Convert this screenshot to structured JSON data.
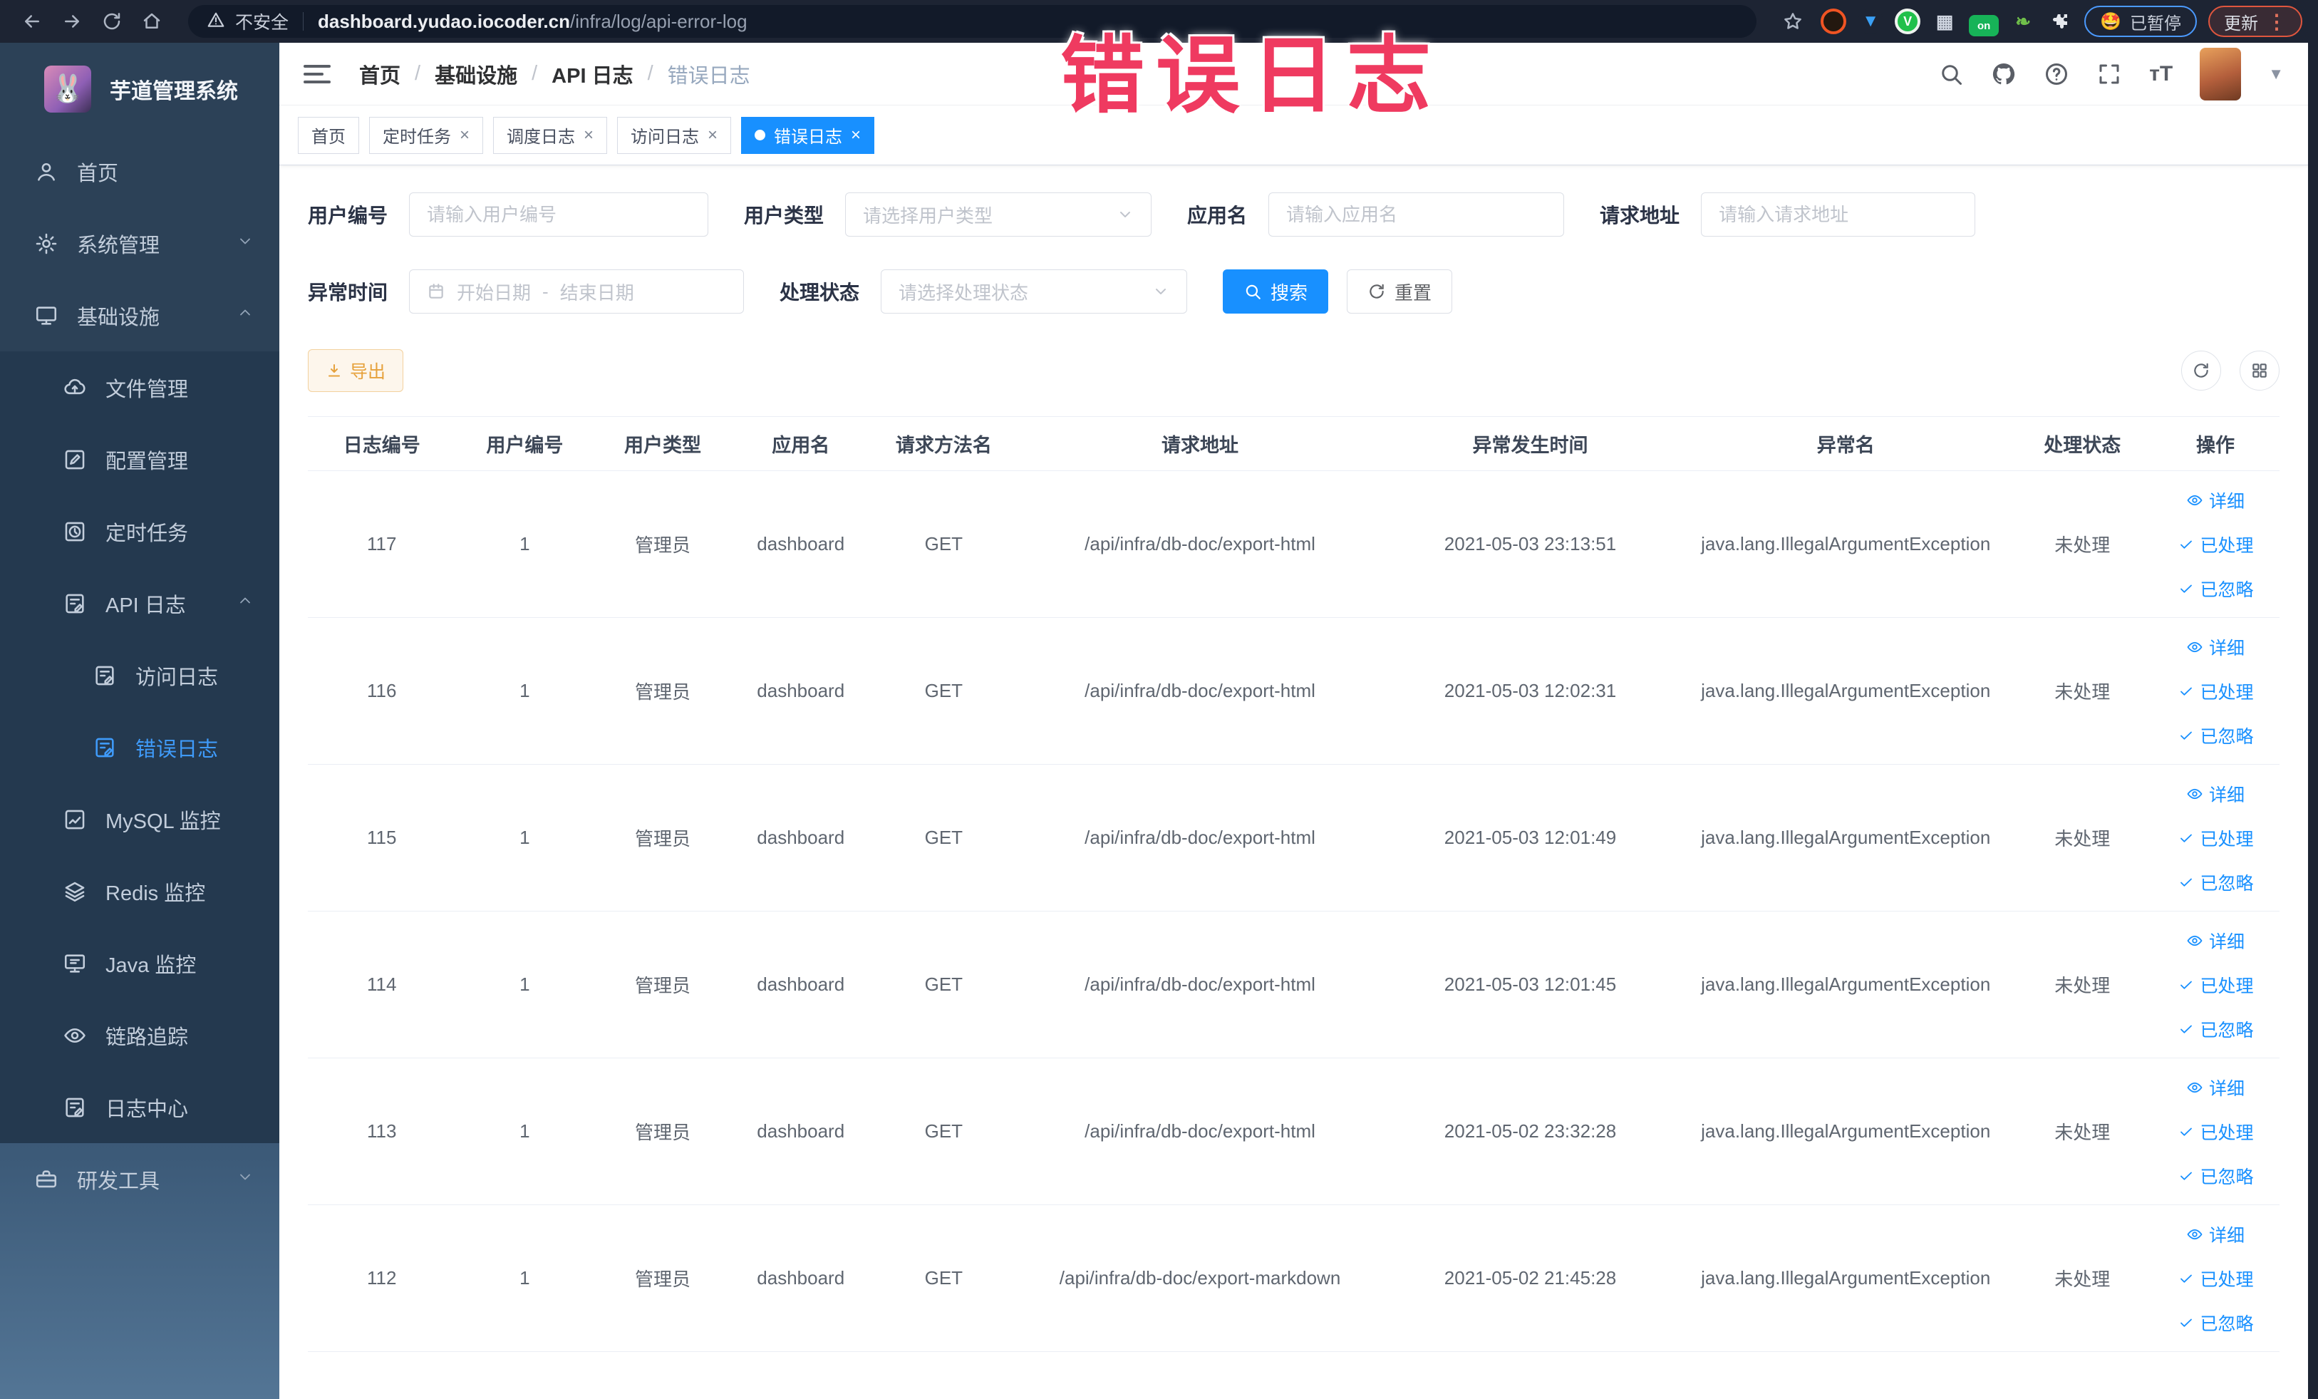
{
  "browser": {
    "security_label": "不安全",
    "url_domain": "dashboard.yudao.iocoder.cn",
    "url_path": "/infra/log/api-error-log",
    "paused_label": "已暂停",
    "paused_emoji": "🤩",
    "update_label": "更新"
  },
  "annotation": {
    "text": "错误日志",
    "color": "#ef3a60"
  },
  "app": {
    "title": "芋道管理系统",
    "breadcrumb": [
      "首页",
      "基础设施",
      "API 日志",
      "错误日志"
    ]
  },
  "sidebar": {
    "items": [
      {
        "label": "首页",
        "icon": "user",
        "level": 1,
        "group": "top"
      },
      {
        "label": "系统管理",
        "icon": "gear",
        "level": 1,
        "group": "top",
        "chevron": "down"
      },
      {
        "label": "基础设施",
        "icon": "monitor",
        "level": 1,
        "group": "top",
        "chevron": "up"
      },
      {
        "label": "文件管理",
        "icon": "cloud",
        "level": 2,
        "group": "sub"
      },
      {
        "label": "配置管理",
        "icon": "editsq",
        "level": 2,
        "group": "sub"
      },
      {
        "label": "定时任务",
        "icon": "clock",
        "level": 2,
        "group": "sub"
      },
      {
        "label": "API 日志",
        "icon": "docpen",
        "level": 2,
        "group": "sub",
        "chevron": "up"
      },
      {
        "label": "访问日志",
        "icon": "docpen",
        "level": 3,
        "group": "sub"
      },
      {
        "label": "错误日志",
        "icon": "docpen",
        "level": 3,
        "group": "sub",
        "active": true
      },
      {
        "label": "MySQL 监控",
        "icon": "chart",
        "level": 2,
        "group": "sub"
      },
      {
        "label": "Redis 监控",
        "icon": "layers",
        "level": 2,
        "group": "sub"
      },
      {
        "label": "Java 监控",
        "icon": "javamon",
        "level": 2,
        "group": "sub"
      },
      {
        "label": "链路追踪",
        "icon": "eye",
        "level": 2,
        "group": "sub"
      },
      {
        "label": "日志中心",
        "icon": "docpen",
        "level": 2,
        "group": "sub"
      },
      {
        "label": "研发工具",
        "icon": "toolbox",
        "level": 1,
        "group": "bottom",
        "chevron": "down"
      }
    ]
  },
  "tabs": [
    {
      "label": "首页",
      "closable": false,
      "active": false
    },
    {
      "label": "定时任务",
      "closable": true,
      "active": false
    },
    {
      "label": "调度日志",
      "closable": true,
      "active": false
    },
    {
      "label": "访问日志",
      "closable": true,
      "active": false
    },
    {
      "label": "错误日志",
      "closable": true,
      "active": true
    }
  ],
  "filters": {
    "user_id": {
      "label": "用户编号",
      "placeholder": "请输入用户编号"
    },
    "user_type": {
      "label": "用户类型",
      "placeholder": "请选择用户类型"
    },
    "app_name": {
      "label": "应用名",
      "placeholder": "请输入应用名"
    },
    "request_url": {
      "label": "请求地址",
      "placeholder": "请输入请求地址"
    },
    "exception_time": {
      "label": "异常时间",
      "start_placeholder": "开始日期",
      "separator": "-",
      "end_placeholder": "结束日期"
    },
    "process_status": {
      "label": "处理状态",
      "placeholder": "请选择处理状态"
    },
    "search_label": "搜索",
    "reset_label": "重置"
  },
  "toolbar": {
    "export_label": "导出"
  },
  "table": {
    "columns": [
      "日志编号",
      "用户编号",
      "用户类型",
      "应用名",
      "请求方法名",
      "请求地址",
      "异常发生时间",
      "异常名",
      "处理状态",
      "操作"
    ],
    "actions": [
      "详细",
      "已处理",
      "已忽略"
    ],
    "rows": [
      {
        "id": "117",
        "user_id": "1",
        "user_type": "管理员",
        "app": "dashboard",
        "method": "GET",
        "url": "/api/infra/db-doc/export-html",
        "time": "2021-05-03 23:13:51",
        "exception": "java.lang.IllegalArgumentException",
        "status": "未处理"
      },
      {
        "id": "116",
        "user_id": "1",
        "user_type": "管理员",
        "app": "dashboard",
        "method": "GET",
        "url": "/api/infra/db-doc/export-html",
        "time": "2021-05-03 12:02:31",
        "exception": "java.lang.IllegalArgumentException",
        "status": "未处理"
      },
      {
        "id": "115",
        "user_id": "1",
        "user_type": "管理员",
        "app": "dashboard",
        "method": "GET",
        "url": "/api/infra/db-doc/export-html",
        "time": "2021-05-03 12:01:49",
        "exception": "java.lang.IllegalArgumentException",
        "status": "未处理"
      },
      {
        "id": "114",
        "user_id": "1",
        "user_type": "管理员",
        "app": "dashboard",
        "method": "GET",
        "url": "/api/infra/db-doc/export-html",
        "time": "2021-05-03 12:01:45",
        "exception": "java.lang.IllegalArgumentException",
        "status": "未处理"
      },
      {
        "id": "113",
        "user_id": "1",
        "user_type": "管理员",
        "app": "dashboard",
        "method": "GET",
        "url": "/api/infra/db-doc/export-html",
        "time": "2021-05-02 23:32:28",
        "exception": "java.lang.IllegalArgumentException",
        "status": "未处理"
      },
      {
        "id": "112",
        "user_id": "1",
        "user_type": "管理员",
        "app": "dashboard",
        "method": "GET",
        "url": "/api/infra/db-doc/export-markdown",
        "time": "2021-05-02 21:45:28",
        "exception": "java.lang.IllegalArgumentException",
        "status": "未处理"
      }
    ]
  },
  "colors": {
    "accent": "#1890ff",
    "active_tab": "#1890ff",
    "export_warning": "#e6a23c",
    "annotation": "#ef3a60",
    "sidebar_bg": "#2c4157",
    "chrome_bg": "#1d2433"
  }
}
